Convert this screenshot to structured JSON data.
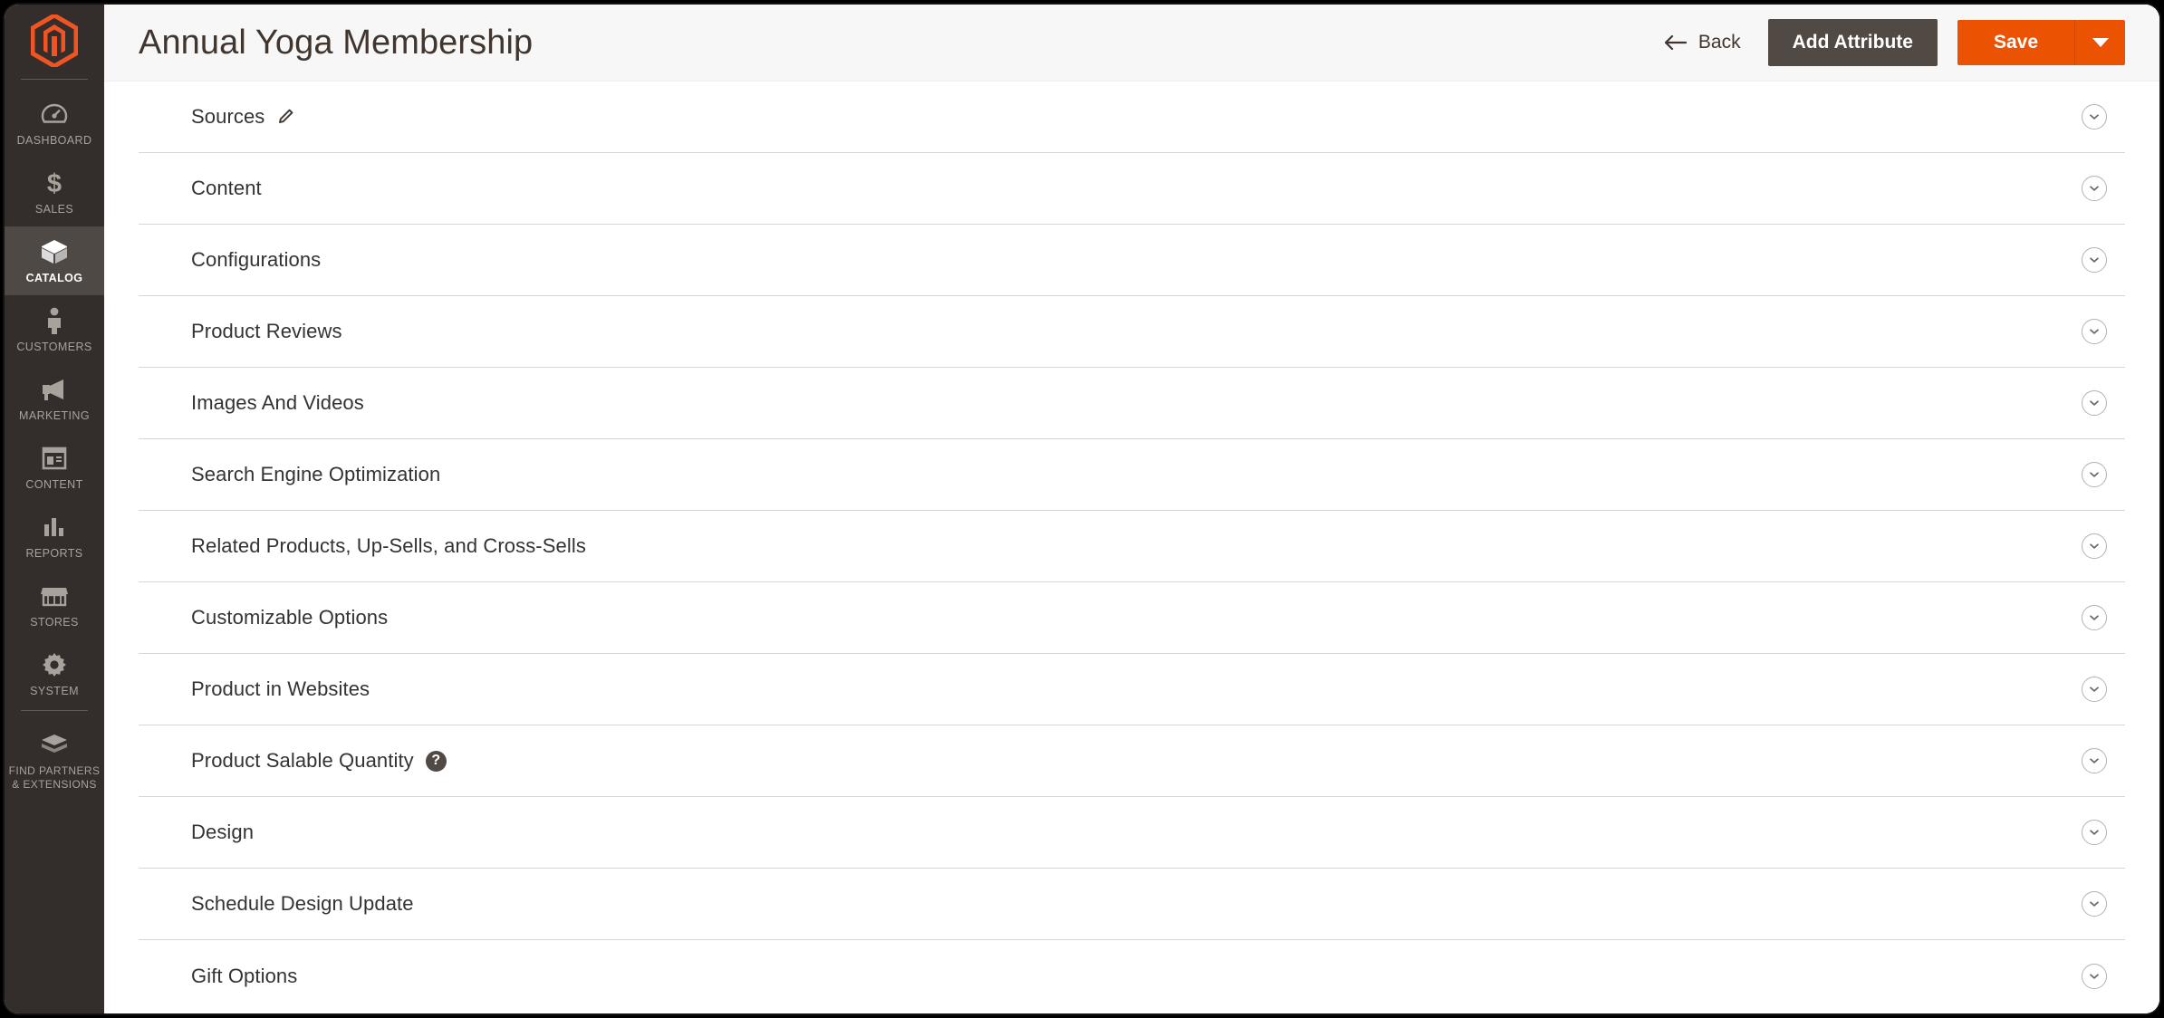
{
  "sidebar": {
    "logo": "magento-logo",
    "items": [
      {
        "label": "DASHBOARD",
        "icon": "dashboard-gauge-icon",
        "active": false
      },
      {
        "label": "SALES",
        "icon": "dollar-sign-icon",
        "active": false
      },
      {
        "label": "CATALOG",
        "icon": "box-icon",
        "active": true
      },
      {
        "label": "CUSTOMERS",
        "icon": "person-icon",
        "active": false
      },
      {
        "label": "MARKETING",
        "icon": "megaphone-icon",
        "active": false
      },
      {
        "label": "CONTENT",
        "icon": "layout-page-icon",
        "active": false
      },
      {
        "label": "REPORTS",
        "icon": "bar-chart-icon",
        "active": false
      },
      {
        "label": "STORES",
        "icon": "storefront-icon",
        "active": false
      },
      {
        "label": "SYSTEM",
        "icon": "gear-icon",
        "active": false
      },
      {
        "label": "FIND PARTNERS & EXTENSIONS",
        "icon": "extension-box-icon",
        "active": false
      }
    ]
  },
  "header": {
    "title": "Annual Yoga Membership",
    "back_label": "Back",
    "back_icon": "arrow-left-icon",
    "add_attribute_label": "Add Attribute",
    "save_label": "Save",
    "save_toggle_icon": "caret-down-icon"
  },
  "colors": {
    "accent_orange": "#eb5202",
    "sidebar_dark": "#332e2b",
    "sidebar_active": "#4f4945",
    "button_dark": "#514943",
    "header_bg": "#f7f7f7",
    "divider": "#d6d6d6"
  },
  "sections": [
    {
      "label": "Sources",
      "collapse_icon": "chevron-down-circle-icon",
      "edit_icon": "pencil-icon",
      "help_icon": null
    },
    {
      "label": "Content",
      "collapse_icon": "chevron-down-circle-icon",
      "edit_icon": null,
      "help_icon": null
    },
    {
      "label": "Configurations",
      "collapse_icon": "chevron-down-circle-icon",
      "edit_icon": null,
      "help_icon": null
    },
    {
      "label": "Product Reviews",
      "collapse_icon": "chevron-down-circle-icon",
      "edit_icon": null,
      "help_icon": null
    },
    {
      "label": "Images And Videos",
      "collapse_icon": "chevron-down-circle-icon",
      "edit_icon": null,
      "help_icon": null
    },
    {
      "label": "Search Engine Optimization",
      "collapse_icon": "chevron-down-circle-icon",
      "edit_icon": null,
      "help_icon": null
    },
    {
      "label": "Related Products, Up-Sells, and Cross-Sells",
      "collapse_icon": "chevron-down-circle-icon",
      "edit_icon": null,
      "help_icon": null
    },
    {
      "label": "Customizable Options",
      "collapse_icon": "chevron-down-circle-icon",
      "edit_icon": null,
      "help_icon": null
    },
    {
      "label": "Product in Websites",
      "collapse_icon": "chevron-down-circle-icon",
      "edit_icon": null,
      "help_icon": null
    },
    {
      "label": "Product Salable Quantity",
      "collapse_icon": "chevron-down-circle-icon",
      "edit_icon": null,
      "help_icon": "?"
    },
    {
      "label": "Design",
      "collapse_icon": "chevron-down-circle-icon",
      "edit_icon": null,
      "help_icon": null
    },
    {
      "label": "Schedule Design Update",
      "collapse_icon": "chevron-down-circle-icon",
      "edit_icon": null,
      "help_icon": null
    },
    {
      "label": "Gift Options",
      "collapse_icon": "chevron-down-circle-icon",
      "edit_icon": null,
      "help_icon": null
    }
  ]
}
